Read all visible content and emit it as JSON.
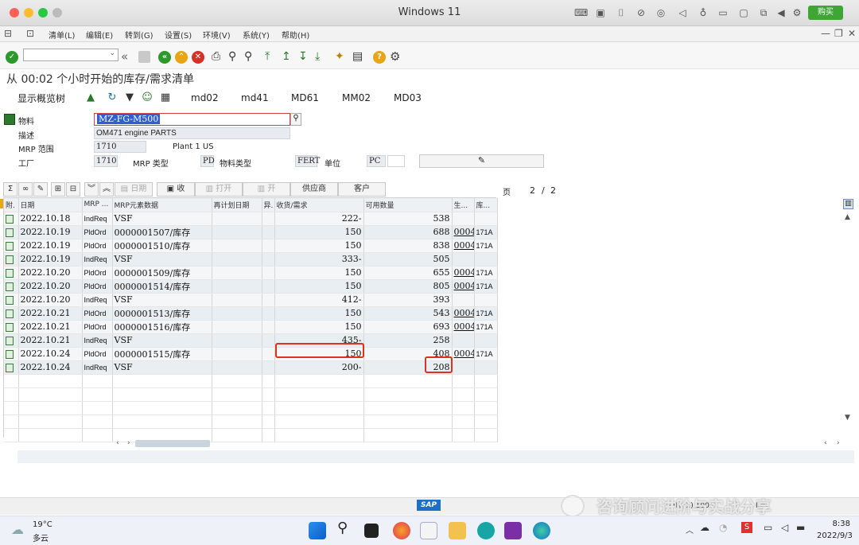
{
  "window_title": "Windows 11",
  "buy_button": "购买",
  "menu": [
    "清单(L)",
    "编辑(E)",
    "转到(G)",
    "设置(S)",
    "环境(V)",
    "系统(Y)",
    "帮助(H)"
  ],
  "page_title": "从 00:02 个小时开始的库存/需求清单",
  "app_toolbar": {
    "show_tree": "显示概览树",
    "tabs": [
      "md02",
      "md41",
      "MD61",
      "MM02",
      "MD03"
    ]
  },
  "header": {
    "material_label": "物料",
    "material_value": "MZ-FG-M500",
    "desc_label": "描述",
    "desc_value": "OM471 engine PARTS",
    "mrp_area_label": "MRP 范围",
    "mrp_area_value": "1710",
    "mrp_area_text": "Plant 1 US",
    "plant_label": "工厂",
    "plant_value": "1710",
    "mrp_type_label": "MRP 类型",
    "mrp_type_value": "PD",
    "mat_type_label": "物料类型",
    "mat_type_value": "FERT",
    "unit_label": "单位",
    "unit_value": "PC"
  },
  "grid_toolbar": {
    "date": "日期",
    "receive": "收",
    "open": "打开",
    "open2": "开",
    "vendor": "供应商",
    "customer": "客户",
    "page_label": "页",
    "page_current": "2",
    "page_sep": "/",
    "page_total": "2"
  },
  "columns": [
    "附.",
    "日期",
    "MRP ...",
    "MRP元素数据",
    "再计划日期",
    "异.",
    "收货/需求",
    "可用数量",
    "生...",
    "库..."
  ],
  "rows": [
    {
      "date": "2022.10.18",
      "mrp": "IndReq",
      "data": "VSF",
      "qty": "222-",
      "avail": "538",
      "prod": "",
      "stor": ""
    },
    {
      "date": "2022.10.19",
      "mrp": "PldOrd",
      "data": "0000001507/库存",
      "qty": "150",
      "avail": "688",
      "prod": "0004",
      "stor": "171A"
    },
    {
      "date": "2022.10.19",
      "mrp": "PldOrd",
      "data": "0000001510/库存",
      "qty": "150",
      "avail": "838",
      "prod": "0004",
      "stor": "171A"
    },
    {
      "date": "2022.10.19",
      "mrp": "IndReq",
      "data": "VSF",
      "qty": "333-",
      "avail": "505",
      "prod": "",
      "stor": ""
    },
    {
      "date": "2022.10.20",
      "mrp": "PldOrd",
      "data": "0000001509/库存",
      "qty": "150",
      "avail": "655",
      "prod": "0004",
      "stor": "171A"
    },
    {
      "date": "2022.10.20",
      "mrp": "PldOrd",
      "data": "0000001514/库存",
      "qty": "150",
      "avail": "805",
      "prod": "0004",
      "stor": "171A"
    },
    {
      "date": "2022.10.20",
      "mrp": "IndReq",
      "data": "VSF",
      "qty": "412-",
      "avail": "393",
      "prod": "",
      "stor": ""
    },
    {
      "date": "2022.10.21",
      "mrp": "PldOrd",
      "data": "0000001513/库存",
      "qty": "150",
      "avail": "543",
      "prod": "0004",
      "stor": "171A"
    },
    {
      "date": "2022.10.21",
      "mrp": "PldOrd",
      "data": "0000001516/库存",
      "qty": "150",
      "avail": "693",
      "prod": "0004",
      "stor": "171A"
    },
    {
      "date": "2022.10.21",
      "mrp": "IndReq",
      "data": "VSF",
      "qty": "435-",
      "avail": "258",
      "prod": "",
      "stor": ""
    },
    {
      "date": "2022.10.24",
      "mrp": "PldOrd",
      "data": "0000001515/库存",
      "qty": "150",
      "avail": "408",
      "prod": "0004",
      "stor": "171A"
    },
    {
      "date": "2022.10.24",
      "mrp": "IndReq",
      "data": "VSF",
      "qty": "200-",
      "avail": "208",
      "prod": "",
      "stor": ""
    }
  ],
  "statusbar": {
    "sap": "SAP",
    "session": "S4H (2) 100",
    "mode": "INS"
  },
  "watermark": "咨询顾问进阶与实战分享",
  "taskbar": {
    "temp": "19°C",
    "weather": "多云",
    "time": "8:38",
    "date": "2022/9/3"
  }
}
